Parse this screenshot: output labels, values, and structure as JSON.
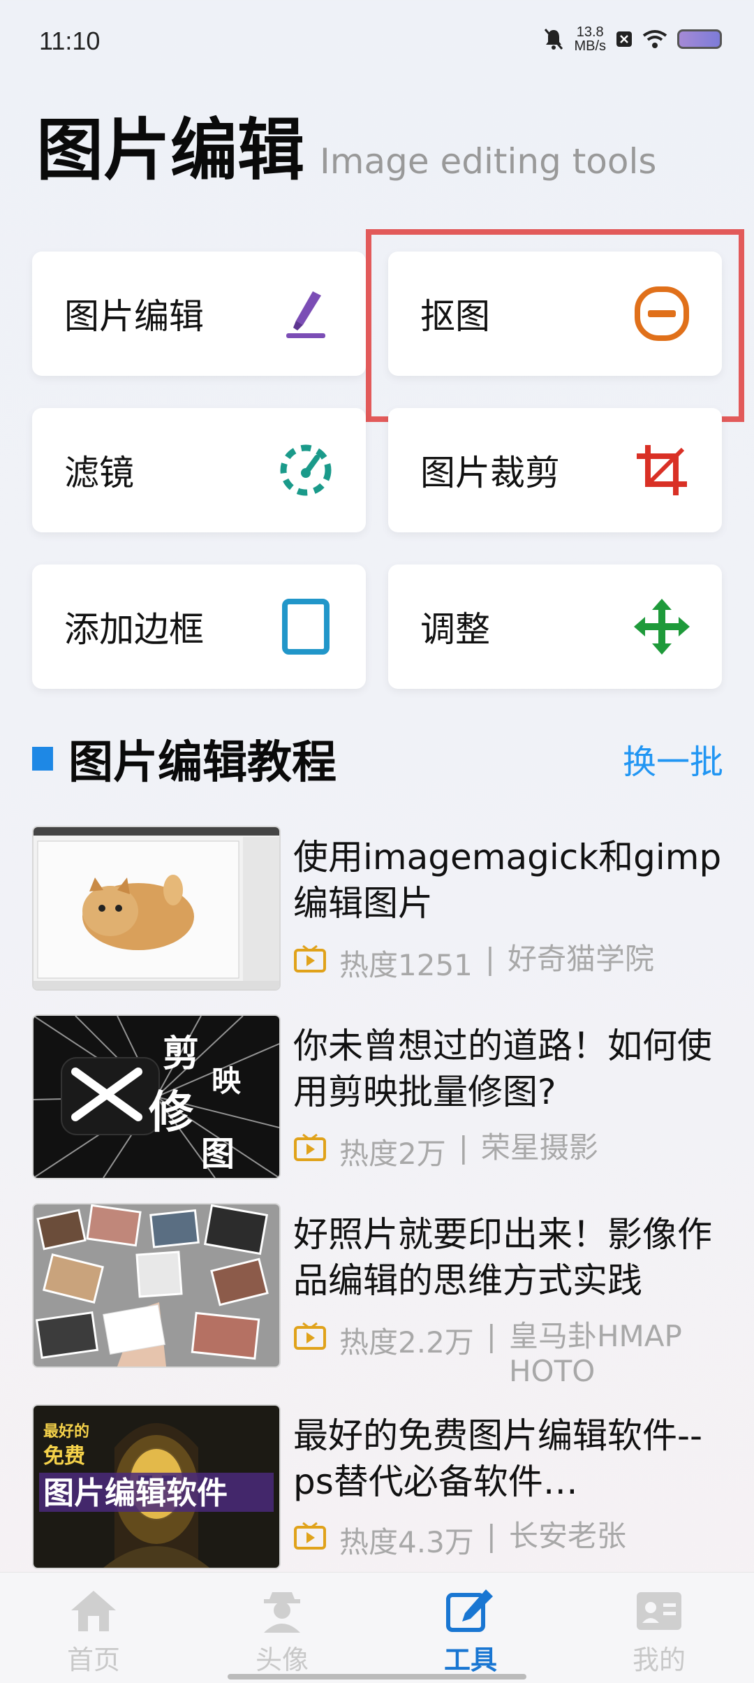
{
  "status": {
    "time": "11:10",
    "speed_value": "13.8",
    "speed_unit": "MB/s"
  },
  "header": {
    "title": "图片编辑",
    "subtitle": "Image editing tools"
  },
  "tools": [
    {
      "label": "图片编辑",
      "icon": "brush-icon",
      "color": "#7b4db5"
    },
    {
      "label": "抠图",
      "icon": "minus-circle-icon",
      "color": "#e0701a"
    },
    {
      "label": "滤镜",
      "icon": "gauge-icon",
      "color": "#1a9a8a"
    },
    {
      "label": "图片裁剪",
      "icon": "crop-icon",
      "color": "#d93025"
    },
    {
      "label": "添加边框",
      "icon": "frame-icon",
      "color": "#2196c9"
    },
    {
      "label": "调整",
      "icon": "move-icon",
      "color": "#1e9a3a"
    }
  ],
  "section": {
    "title": "图片编辑教程",
    "refresh": "换一批"
  },
  "articles": [
    {
      "title": "使用imagemagick和gimp编辑图片",
      "heat": "热度1251",
      "author": "好奇猫学院"
    },
    {
      "title": "你未曾想过的道路！如何使用剪映批量修图?",
      "heat": "热度2万",
      "author": "荣星摄影",
      "thumb_text": [
        "剪",
        "映",
        "修",
        "图"
      ]
    },
    {
      "title": "好照片就要印出来！影像作品编辑的思维方式实践",
      "heat": "热度2.2万",
      "author": "皇马卦HMAPHOTO"
    },
    {
      "title": "最好的免费图片编辑软件--ps替代必备软件…",
      "heat": "热度4.3万",
      "author": "长安老张",
      "thumb_text": [
        "最好的",
        "免费",
        "图片编辑软件"
      ]
    }
  ],
  "meta_separator": "|",
  "nav": [
    {
      "label": "首页",
      "icon": "home-icon",
      "active": false
    },
    {
      "label": "头像",
      "icon": "avatar-icon",
      "active": false
    },
    {
      "label": "工具",
      "icon": "edit-icon",
      "active": true
    },
    {
      "label": "我的",
      "icon": "profile-card-icon",
      "active": false
    }
  ]
}
